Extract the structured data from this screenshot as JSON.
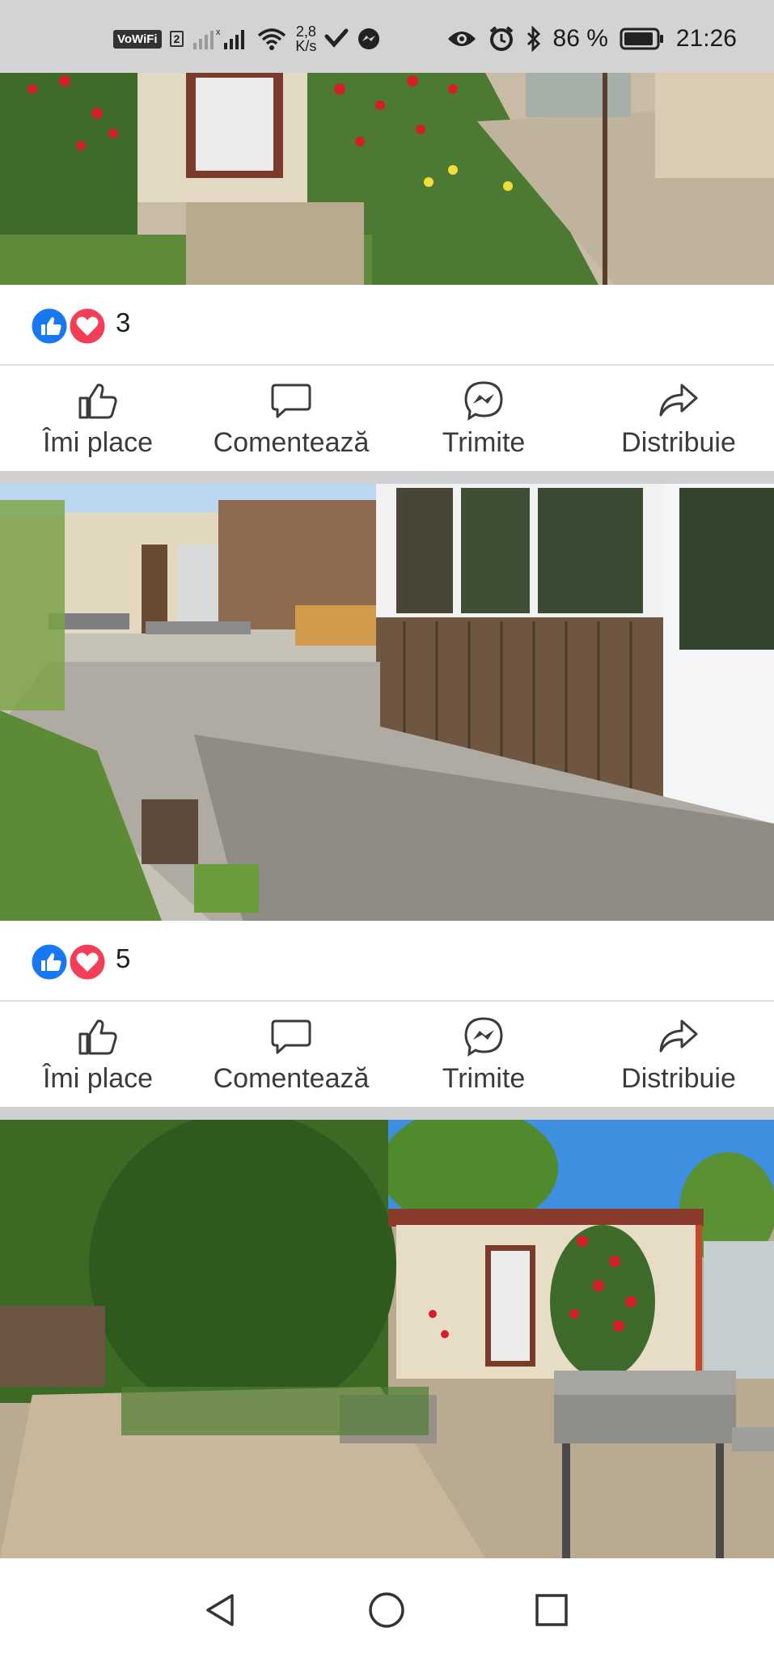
{
  "status_bar": {
    "network_label": "VoWiFi",
    "sim_label": "2",
    "speed_value": "2,8",
    "speed_unit": "K/s",
    "battery_percent": "86 %",
    "time": "21:26",
    "icons": [
      "signal-icon",
      "wifi-icon",
      "data-saver-icon",
      "messenger-icon",
      "eye-icon",
      "alarm-icon",
      "bluetooth-icon",
      "battery-icon"
    ]
  },
  "posts": [
    {
      "photo": "image of garden with red roses, shed with window, gravel path",
      "reaction_count": "3",
      "actions": {
        "like": "Îmi place",
        "comment": "Comentează",
        "send": "Trimite",
        "share": "Distribuie"
      }
    },
    {
      "photo": "image of patio with wooden veranda, paving stones, grill tables",
      "reaction_count": "5",
      "actions": {
        "like": "Îmi place",
        "comment": "Comentează",
        "send": "Trimite",
        "share": "Distribuie"
      }
    },
    {
      "photo": "image of yard with conifer tree, small beige shed, roses, metal grill"
    }
  ],
  "colors": {
    "like_blue": "#1877f2",
    "love_red": "#f33e58",
    "status_bar_bg": "#d3d3d3",
    "divider": "#dddfe2"
  },
  "nav": {
    "icons": [
      "back-icon",
      "home-icon",
      "recents-icon"
    ]
  }
}
